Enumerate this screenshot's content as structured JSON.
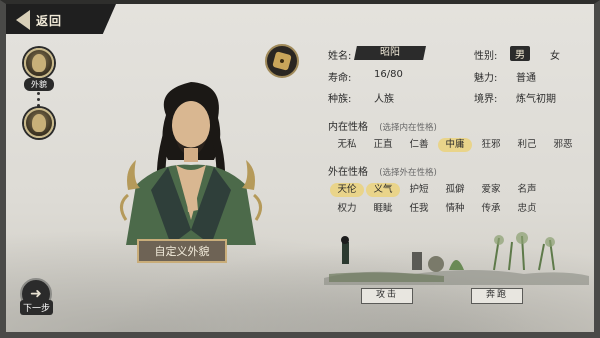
{
  "nav": {
    "back_label": "返回",
    "next_label": "下一步"
  },
  "side": {
    "appearance_label": "外貌"
  },
  "portrait": {
    "customize_label": "自定义外貌"
  },
  "profile": {
    "name_label": "姓名:",
    "name_value": "昭阳",
    "gender_label": "性别:",
    "gender_options": [
      "男",
      "女"
    ],
    "gender_selected": "男",
    "lifespan_label": "寿命:",
    "lifespan_value": "16/80",
    "charm_label": "魅力:",
    "charm_value": "普通",
    "race_label": "种族:",
    "race_value": "人族",
    "realm_label": "境界:",
    "realm_value": "炼气初期"
  },
  "inner": {
    "title": "内在性格",
    "hint": "(选择内在性格)",
    "traits": [
      "无私",
      "正直",
      "仁善",
      "中庸",
      "狂邪",
      "利己",
      "邪恶"
    ],
    "selected": "中庸"
  },
  "outer": {
    "title": "外在性格",
    "hint": "(选择外在性格)",
    "traits_row1": [
      "天伦",
      "义气",
      "护短",
      "孤僻",
      "爱家",
      "名声"
    ],
    "traits_row2": [
      "权力",
      "睚眦",
      "任我",
      "情种",
      "传承",
      "忠贞"
    ],
    "selected": [
      "天伦",
      "义气"
    ]
  },
  "actions": {
    "attack_label": "攻击",
    "flee_label": "奔跑"
  },
  "colors": {
    "accent": "#e9d48a",
    "dark": "#2b2b2b",
    "frame": "#4a4a48"
  },
  "icons": {
    "back": "back-arrow-icon",
    "dice": "dice-icon",
    "next": "next-arrow-icon"
  }
}
